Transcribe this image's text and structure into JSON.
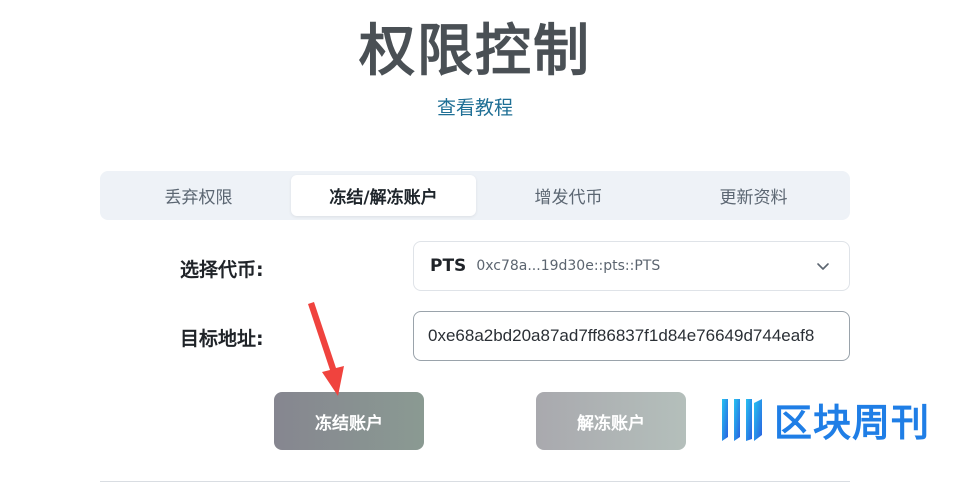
{
  "page": {
    "title": "权限控制",
    "tutorial_link": "查看教程"
  },
  "tabs": [
    {
      "label": "丢弃权限",
      "active": false
    },
    {
      "label": "冻结/解冻账户",
      "active": true
    },
    {
      "label": "增发代币",
      "active": false
    },
    {
      "label": "更新资料",
      "active": false
    }
  ],
  "form": {
    "token_label": "选择代币:",
    "token_symbol": "PTS",
    "token_id": "0xc78a...19d30e::pts::PTS",
    "address_label": "目标地址:",
    "address_value": "0xe68a2bd20a87ad7ff86837f1d84e76649d744eaf8"
  },
  "buttons": {
    "freeze": "冻结账户",
    "unfreeze": "解冻账户"
  },
  "watermark": {
    "text": "区块周刊"
  },
  "colors": {
    "title": "#4a5055",
    "link": "#1f6f95",
    "annotation_arrow": "#f0433e",
    "watermark": "#1f7ee6"
  }
}
